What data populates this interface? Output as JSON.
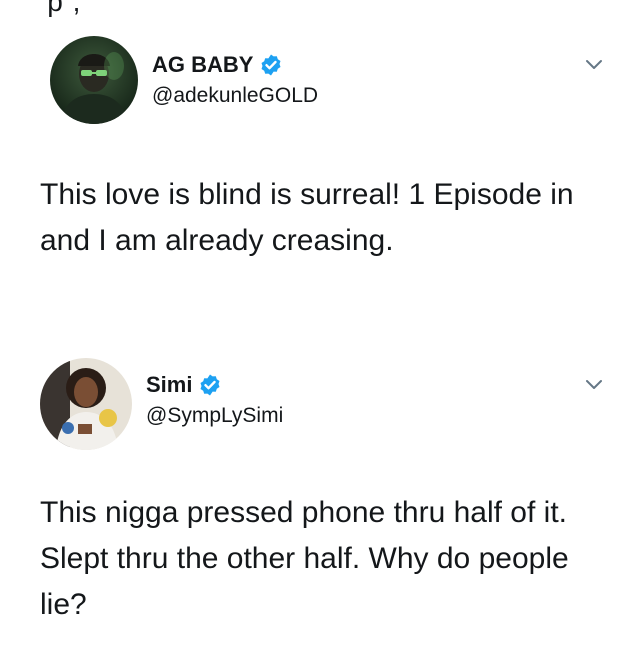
{
  "top_fragment": "‘p          ,",
  "tweets": [
    {
      "display_name": "AG BABY",
      "handle": "@adekunleGOLD",
      "verified": true,
      "text": "This love is blind is surreal! 1 Episode in and I am already creasing.",
      "avatar_icon": "avatar-photo-man-green-glasses",
      "menu_icon": "chevron-down-icon"
    },
    {
      "display_name": "Simi",
      "handle": "@SympLySimi",
      "verified": true,
      "text": "This nigga pressed phone thru half of it. Slept thru the other half. Why do people lie?",
      "avatar_icon": "avatar-photo-woman",
      "menu_icon": "chevron-down-icon"
    }
  ],
  "colors": {
    "verified_badge": "#1da1f2",
    "text": "#14171a",
    "chevron": "#657786",
    "background": "#ffffff"
  }
}
